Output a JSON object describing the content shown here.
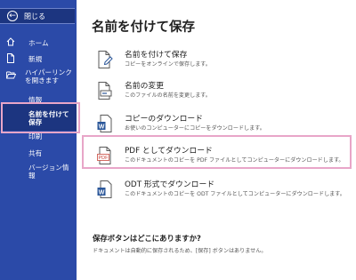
{
  "sidebar": {
    "back_label": "閉じる",
    "items": [
      {
        "id": "home",
        "label": "ホーム",
        "icon": "home-icon"
      },
      {
        "id": "new",
        "label": "新規",
        "icon": "new-document-icon"
      },
      {
        "id": "hyperlink",
        "label": "ハイパーリンクを開きます",
        "icon": "open-folder-icon"
      },
      {
        "id": "info",
        "label": "情報"
      },
      {
        "id": "save-copy",
        "label": "名前を付けて保存",
        "selected": true
      },
      {
        "id": "print",
        "label": "印刷"
      },
      {
        "id": "share",
        "label": "共有"
      },
      {
        "id": "version",
        "label": "バージョン情報"
      }
    ]
  },
  "main": {
    "title": "名前を付けて保存",
    "options": [
      {
        "title": "名前を付けて保存",
        "desc": "コピーをオンラインで保存します。",
        "icon": "save-as-icon"
      },
      {
        "title": "名前の変更",
        "desc": "このファイルの名前を変更します。",
        "icon": "rename-icon"
      },
      {
        "title": "コピーのダウンロード",
        "desc": "お使いのコンピューターにコピーをダウンロードします。",
        "icon": "word-download-icon"
      },
      {
        "title": "PDF としてダウンロード",
        "desc": "このドキュメントのコピーを PDF ファイルとしてコンピューターにダウンロードします。",
        "icon": "pdf-icon",
        "icon_text": "PDF"
      },
      {
        "title": "ODT 形式でダウンロード",
        "desc": "このドキュメントのコピーを ODT ファイルとしてコンピューターにダウンロードします。",
        "icon": "odt-icon"
      }
    ],
    "where_title": "保存ボタンはどこにありますか?",
    "where_text": "ドキュメントは自動的に保存されるため、[保存] ボタンはありません。"
  },
  "colors": {
    "sidebar_bg": "#2b4aa8",
    "sidebar_selected": "#1c3580",
    "highlight": "#e8a6c8",
    "pdf_red": "#c9453b",
    "word_blue": "#2b579a"
  }
}
